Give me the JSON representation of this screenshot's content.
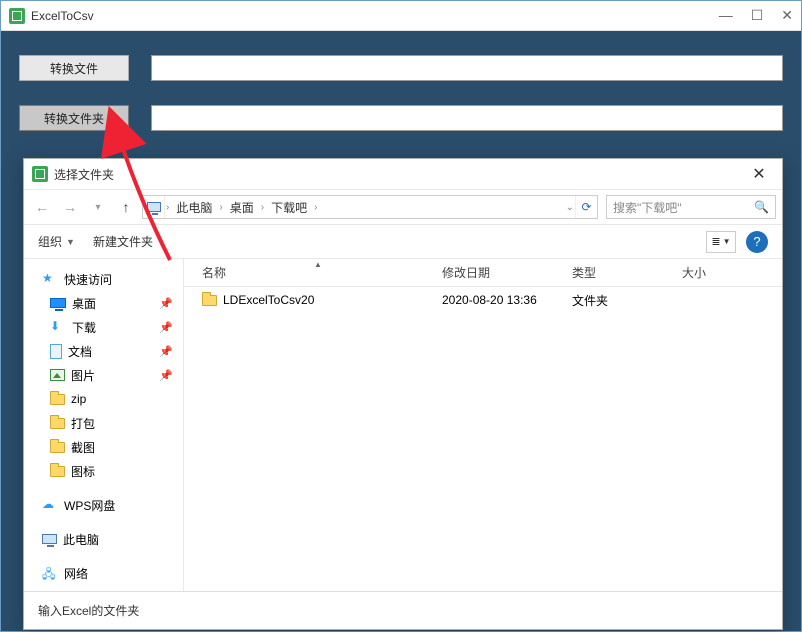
{
  "app": {
    "title": "ExcelToCsv",
    "convert_file_label": "转换文件",
    "convert_folder_label": "转换文件夹"
  },
  "dialog": {
    "title": "选择文件夹",
    "breadcrumb": {
      "root": "此电脑",
      "p1": "桌面",
      "p2": "下载吧"
    },
    "search_placeholder": "搜索\"下载吧\"",
    "toolbar": {
      "organize": "组织",
      "new_folder": "新建文件夹"
    },
    "columns": {
      "name": "名称",
      "date": "修改日期",
      "type": "类型",
      "size": "大小"
    },
    "files": [
      {
        "name": "LDExcelToCsv20",
        "date": "2020-08-20 13:36",
        "type": "文件夹",
        "size": ""
      }
    ],
    "footer_label": "输入Excel的文件夹"
  },
  "sidebar": {
    "quick_access": "快速访问",
    "desktop": "桌面",
    "downloads": "下载",
    "documents": "文档",
    "pictures": "图片",
    "zip": "zip",
    "pack": "打包",
    "screenshot": "截图",
    "icons": "图标",
    "wps": "WPS网盘",
    "this_pc": "此电脑",
    "network": "网络"
  }
}
